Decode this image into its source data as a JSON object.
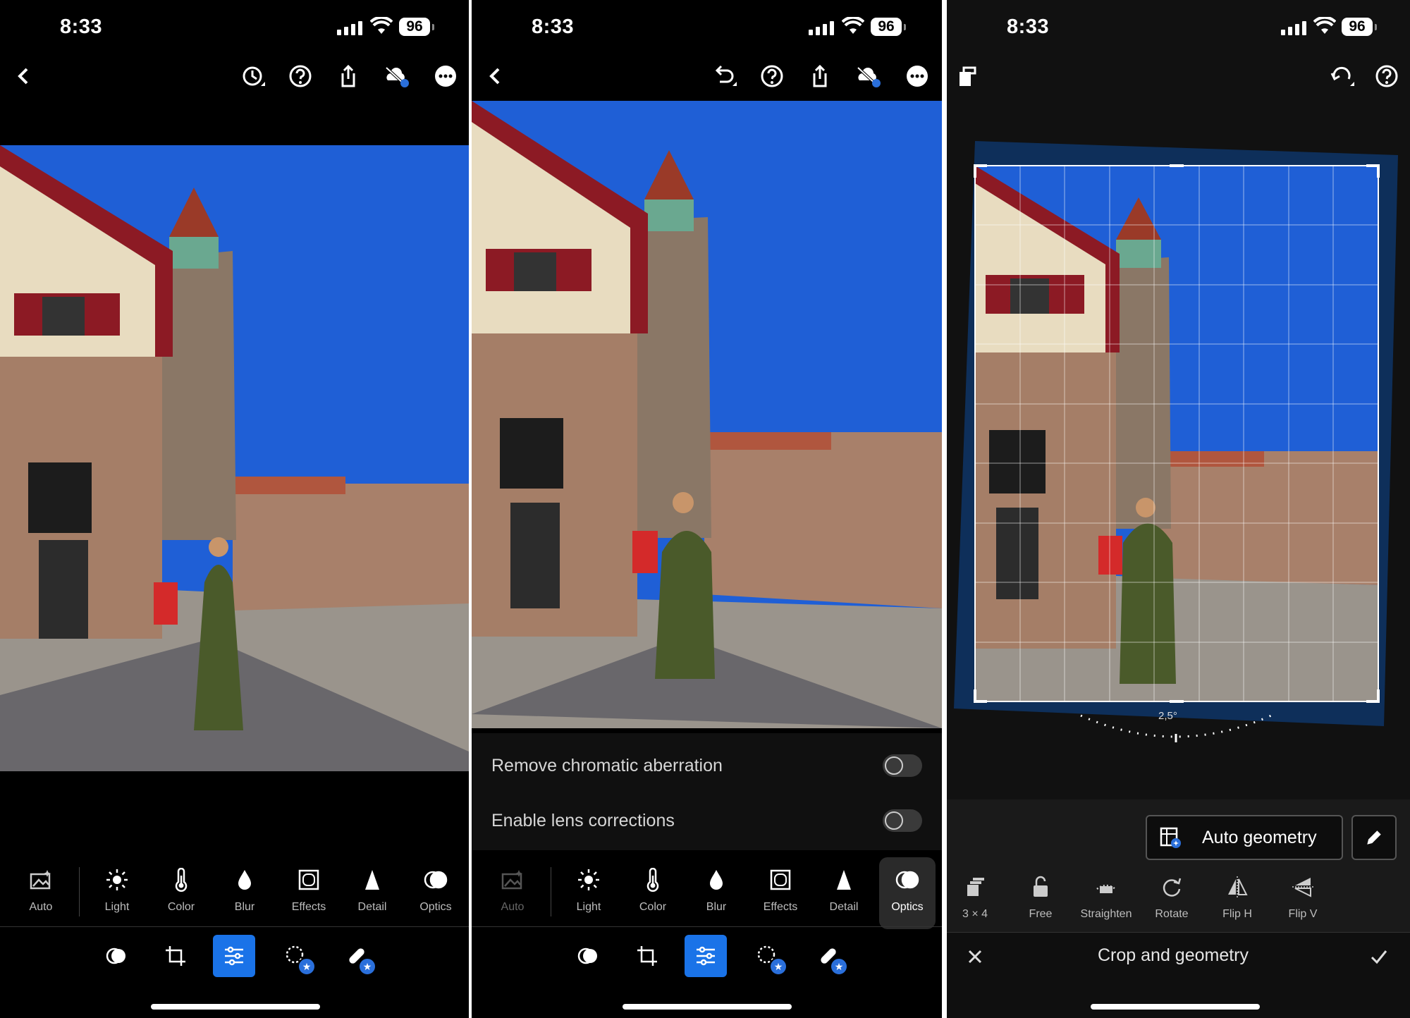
{
  "status": {
    "time": "8:33",
    "battery": "96"
  },
  "panel1": {
    "tools": [
      {
        "label": "Auto",
        "icon": "auto-icon"
      },
      {
        "label": "Light",
        "icon": "sun-icon"
      },
      {
        "label": "Color",
        "icon": "thermometer-icon"
      },
      {
        "label": "Blur",
        "icon": "drop-icon"
      },
      {
        "label": "Effects",
        "icon": "vignette-icon"
      },
      {
        "label": "Detail",
        "icon": "triangle-icon"
      },
      {
        "label": "Optics",
        "icon": "optics-icon"
      }
    ]
  },
  "panel2": {
    "options": [
      {
        "label": "Remove chromatic aberration",
        "enabled": false
      },
      {
        "label": "Enable lens corrections",
        "enabled": false
      }
    ],
    "tools": [
      {
        "label": "Auto",
        "icon": "auto-icon"
      },
      {
        "label": "Light",
        "icon": "sun-icon"
      },
      {
        "label": "Color",
        "icon": "thermometer-icon"
      },
      {
        "label": "Blur",
        "icon": "drop-icon"
      },
      {
        "label": "Effects",
        "icon": "vignette-icon"
      },
      {
        "label": "Detail",
        "icon": "triangle-icon"
      },
      {
        "label": "Optics",
        "icon": "optics-icon"
      }
    ],
    "active_tool": "Optics"
  },
  "panel3": {
    "angle": "2,5°",
    "auto_geometry_label": "Auto geometry",
    "tools": [
      {
        "label": "3 × 4",
        "icon": "aspect-icon"
      },
      {
        "label": "Free",
        "icon": "unlock-icon"
      },
      {
        "label": "Straighten",
        "icon": "straighten-icon"
      },
      {
        "label": "Rotate",
        "icon": "rotate-icon"
      },
      {
        "label": "Flip H",
        "icon": "flip-h-icon"
      },
      {
        "label": "Flip V",
        "icon": "flip-v-icon"
      }
    ],
    "title": "Crop and geometry"
  },
  "colors": {
    "accent": "#1a73e8",
    "badge": "#2a6fdb",
    "sky": "#1f5fd6"
  }
}
